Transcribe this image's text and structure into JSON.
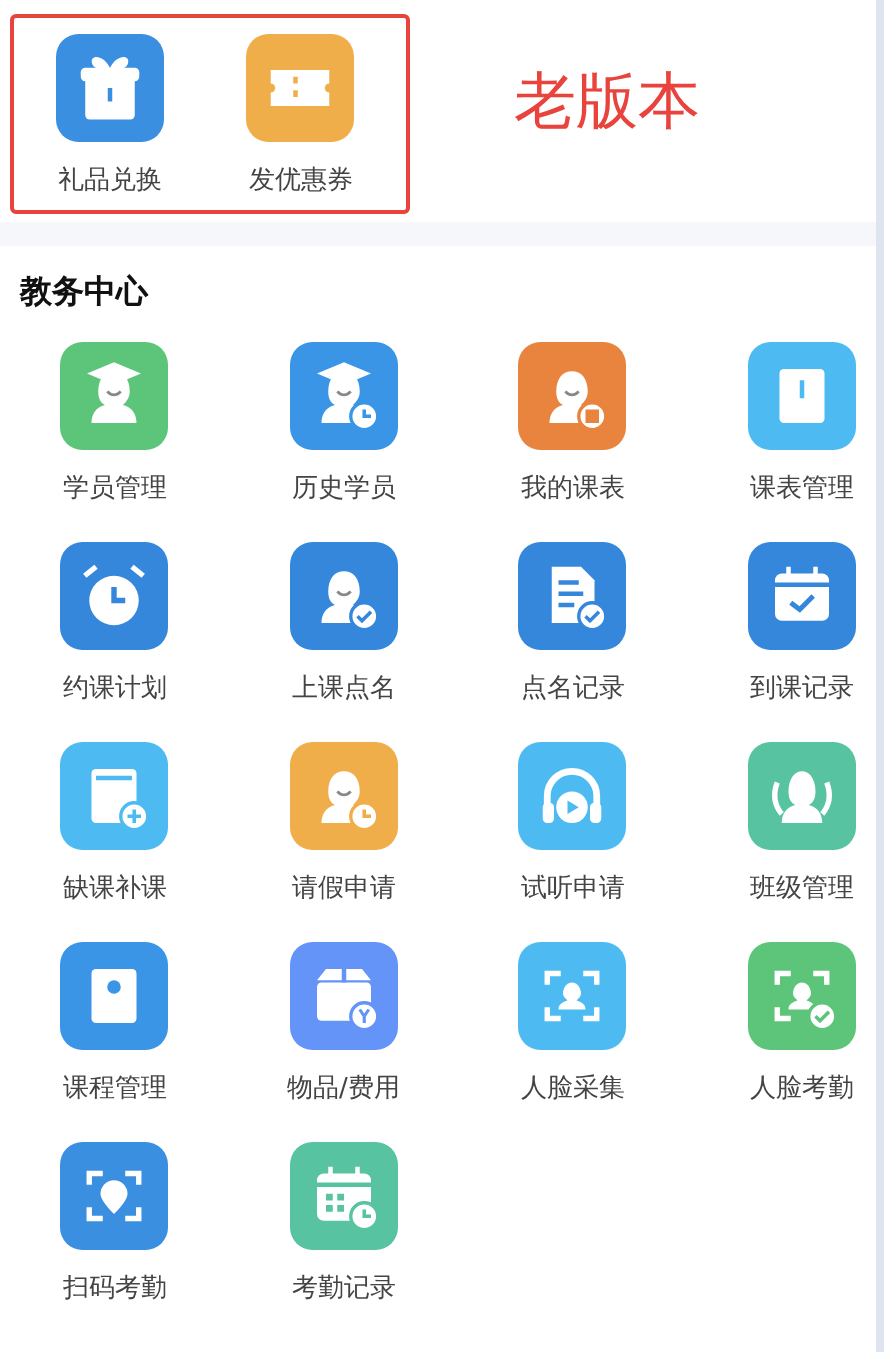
{
  "old_version": {
    "items": [
      {
        "label": "礼品兑换",
        "kind": "gift",
        "color": "#3a8fe0"
      },
      {
        "label": "发优惠券",
        "kind": "ticket",
        "color": "#f0ae4b"
      }
    ],
    "note": "老版本"
  },
  "section": {
    "title": "教务中心",
    "items": [
      {
        "label": "学员管理",
        "kind": "graduate",
        "color": "#5cc57a"
      },
      {
        "label": "历史学员",
        "kind": "graduate-clock",
        "color": "#3a95e6"
      },
      {
        "label": "我的课表",
        "kind": "person-book",
        "color": "#e8843d"
      },
      {
        "label": "课表管理",
        "kind": "book",
        "color": "#4dbbf2"
      },
      {
        "label": "约课计划",
        "kind": "alarm",
        "color": "#3587db"
      },
      {
        "label": "上课点名",
        "kind": "person-check",
        "color": "#3587db"
      },
      {
        "label": "点名记录",
        "kind": "doc-check",
        "color": "#3587db"
      },
      {
        "label": "到课记录",
        "kind": "calendar-check",
        "color": "#3587db"
      },
      {
        "label": "缺课补课",
        "kind": "book-plus",
        "color": "#4dbbf2"
      },
      {
        "label": "请假申请",
        "kind": "person-clock",
        "color": "#f0ae4b"
      },
      {
        "label": "试听申请",
        "kind": "headphone",
        "color": "#4dbbf2"
      },
      {
        "label": "班级管理",
        "kind": "people",
        "color": "#58c3a0"
      },
      {
        "label": "课程管理",
        "kind": "book-gear",
        "color": "#3a95e6"
      },
      {
        "label": "物品/费用",
        "kind": "box",
        "color": "#6494f7"
      },
      {
        "label": "人脸采集",
        "kind": "face-scan",
        "color": "#4dbbf2"
      },
      {
        "label": "人脸考勤",
        "kind": "face-scan-check",
        "color": "#5cc57a"
      },
      {
        "label": "扫码考勤",
        "kind": "scan-pin",
        "color": "#3a8fe0"
      },
      {
        "label": "考勤记录",
        "kind": "calendar-clock",
        "color": "#58c3a0"
      }
    ]
  }
}
